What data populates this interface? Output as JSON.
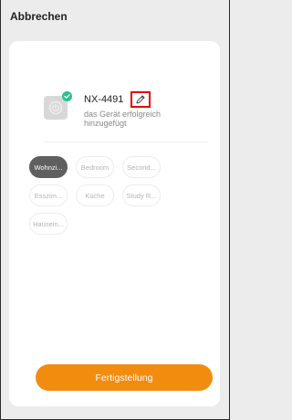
{
  "header": {
    "cancel_label": "Abbrechen"
  },
  "device": {
    "name": "NX-4491",
    "status_text": "das Gerät erfolgreich hinzugefügt",
    "icon": "power-icon",
    "badge_icon": "check-icon",
    "badge_color": "#28c38c"
  },
  "rooms": {
    "chips": [
      {
        "label": "Wohnzi...",
        "selected": true
      },
      {
        "label": "Bedroom",
        "selected": false
      },
      {
        "label": "Second...",
        "selected": false
      },
      {
        "label": "Esszim...",
        "selected": false
      },
      {
        "label": "Küche",
        "selected": false
      },
      {
        "label": "Study R...",
        "selected": false
      },
      {
        "label": "Hausein...",
        "selected": false
      }
    ]
  },
  "footer": {
    "finish_label": "Fertigstellung",
    "finish_color": "#f28c0f"
  }
}
